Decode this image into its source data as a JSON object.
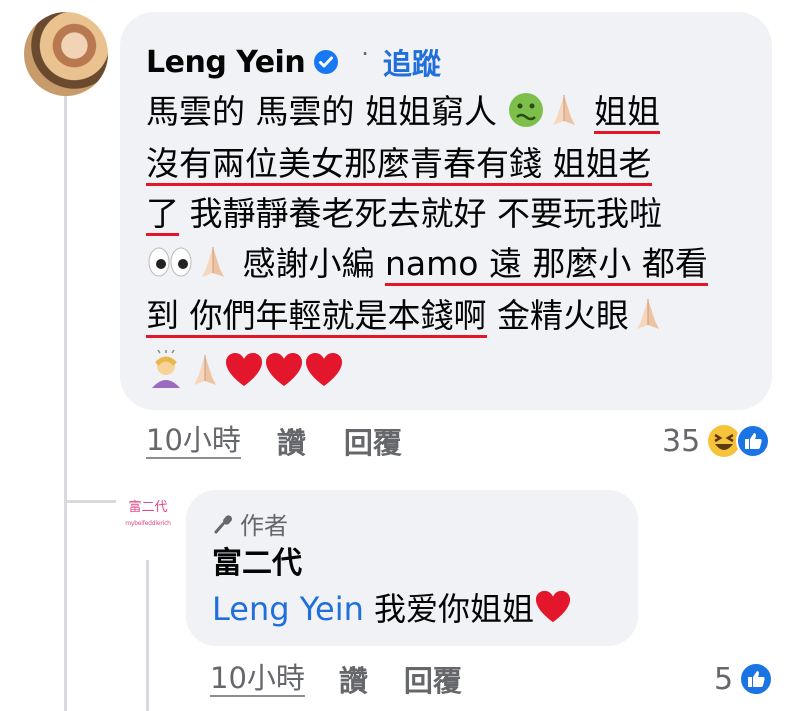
{
  "comment": {
    "author": "Leng Yein",
    "follow_label": "追蹤",
    "dot": "·",
    "lines": {
      "l1a": "馬雲的 馬雲的 姐姐窮人 ",
      "l1b": "姐姐",
      "l2": "沒有兩位美女那麼青春有錢 姐姐老",
      "l3a": "了",
      "l3b": " 我靜靜養老死去就好 不要玩我啦",
      "l4a": " 感謝小編 ",
      "l4b": "namo 遠 那麼小 都看",
      "l5a": "到 你們年輕就是本錢啊",
      "l5b": " 金精火眼"
    },
    "time": "10小時",
    "like_label": "讚",
    "reply_label": "回覆",
    "reaction_count": "35"
  },
  "reply": {
    "avatar_text": "富二代",
    "avatar_sub": "mybeifeddlerich",
    "badge_label": "作者",
    "author": "富二代",
    "mention": "Leng Yein",
    "text": " 我爱你姐姐",
    "time": "10小時",
    "like_label": "讚",
    "reply_label": "回覆",
    "reaction_count": "5"
  },
  "colors": {
    "accent": "#216fdb",
    "underline": "#e5152a",
    "bubble": "#f0f2f5",
    "muted": "#65676b"
  }
}
